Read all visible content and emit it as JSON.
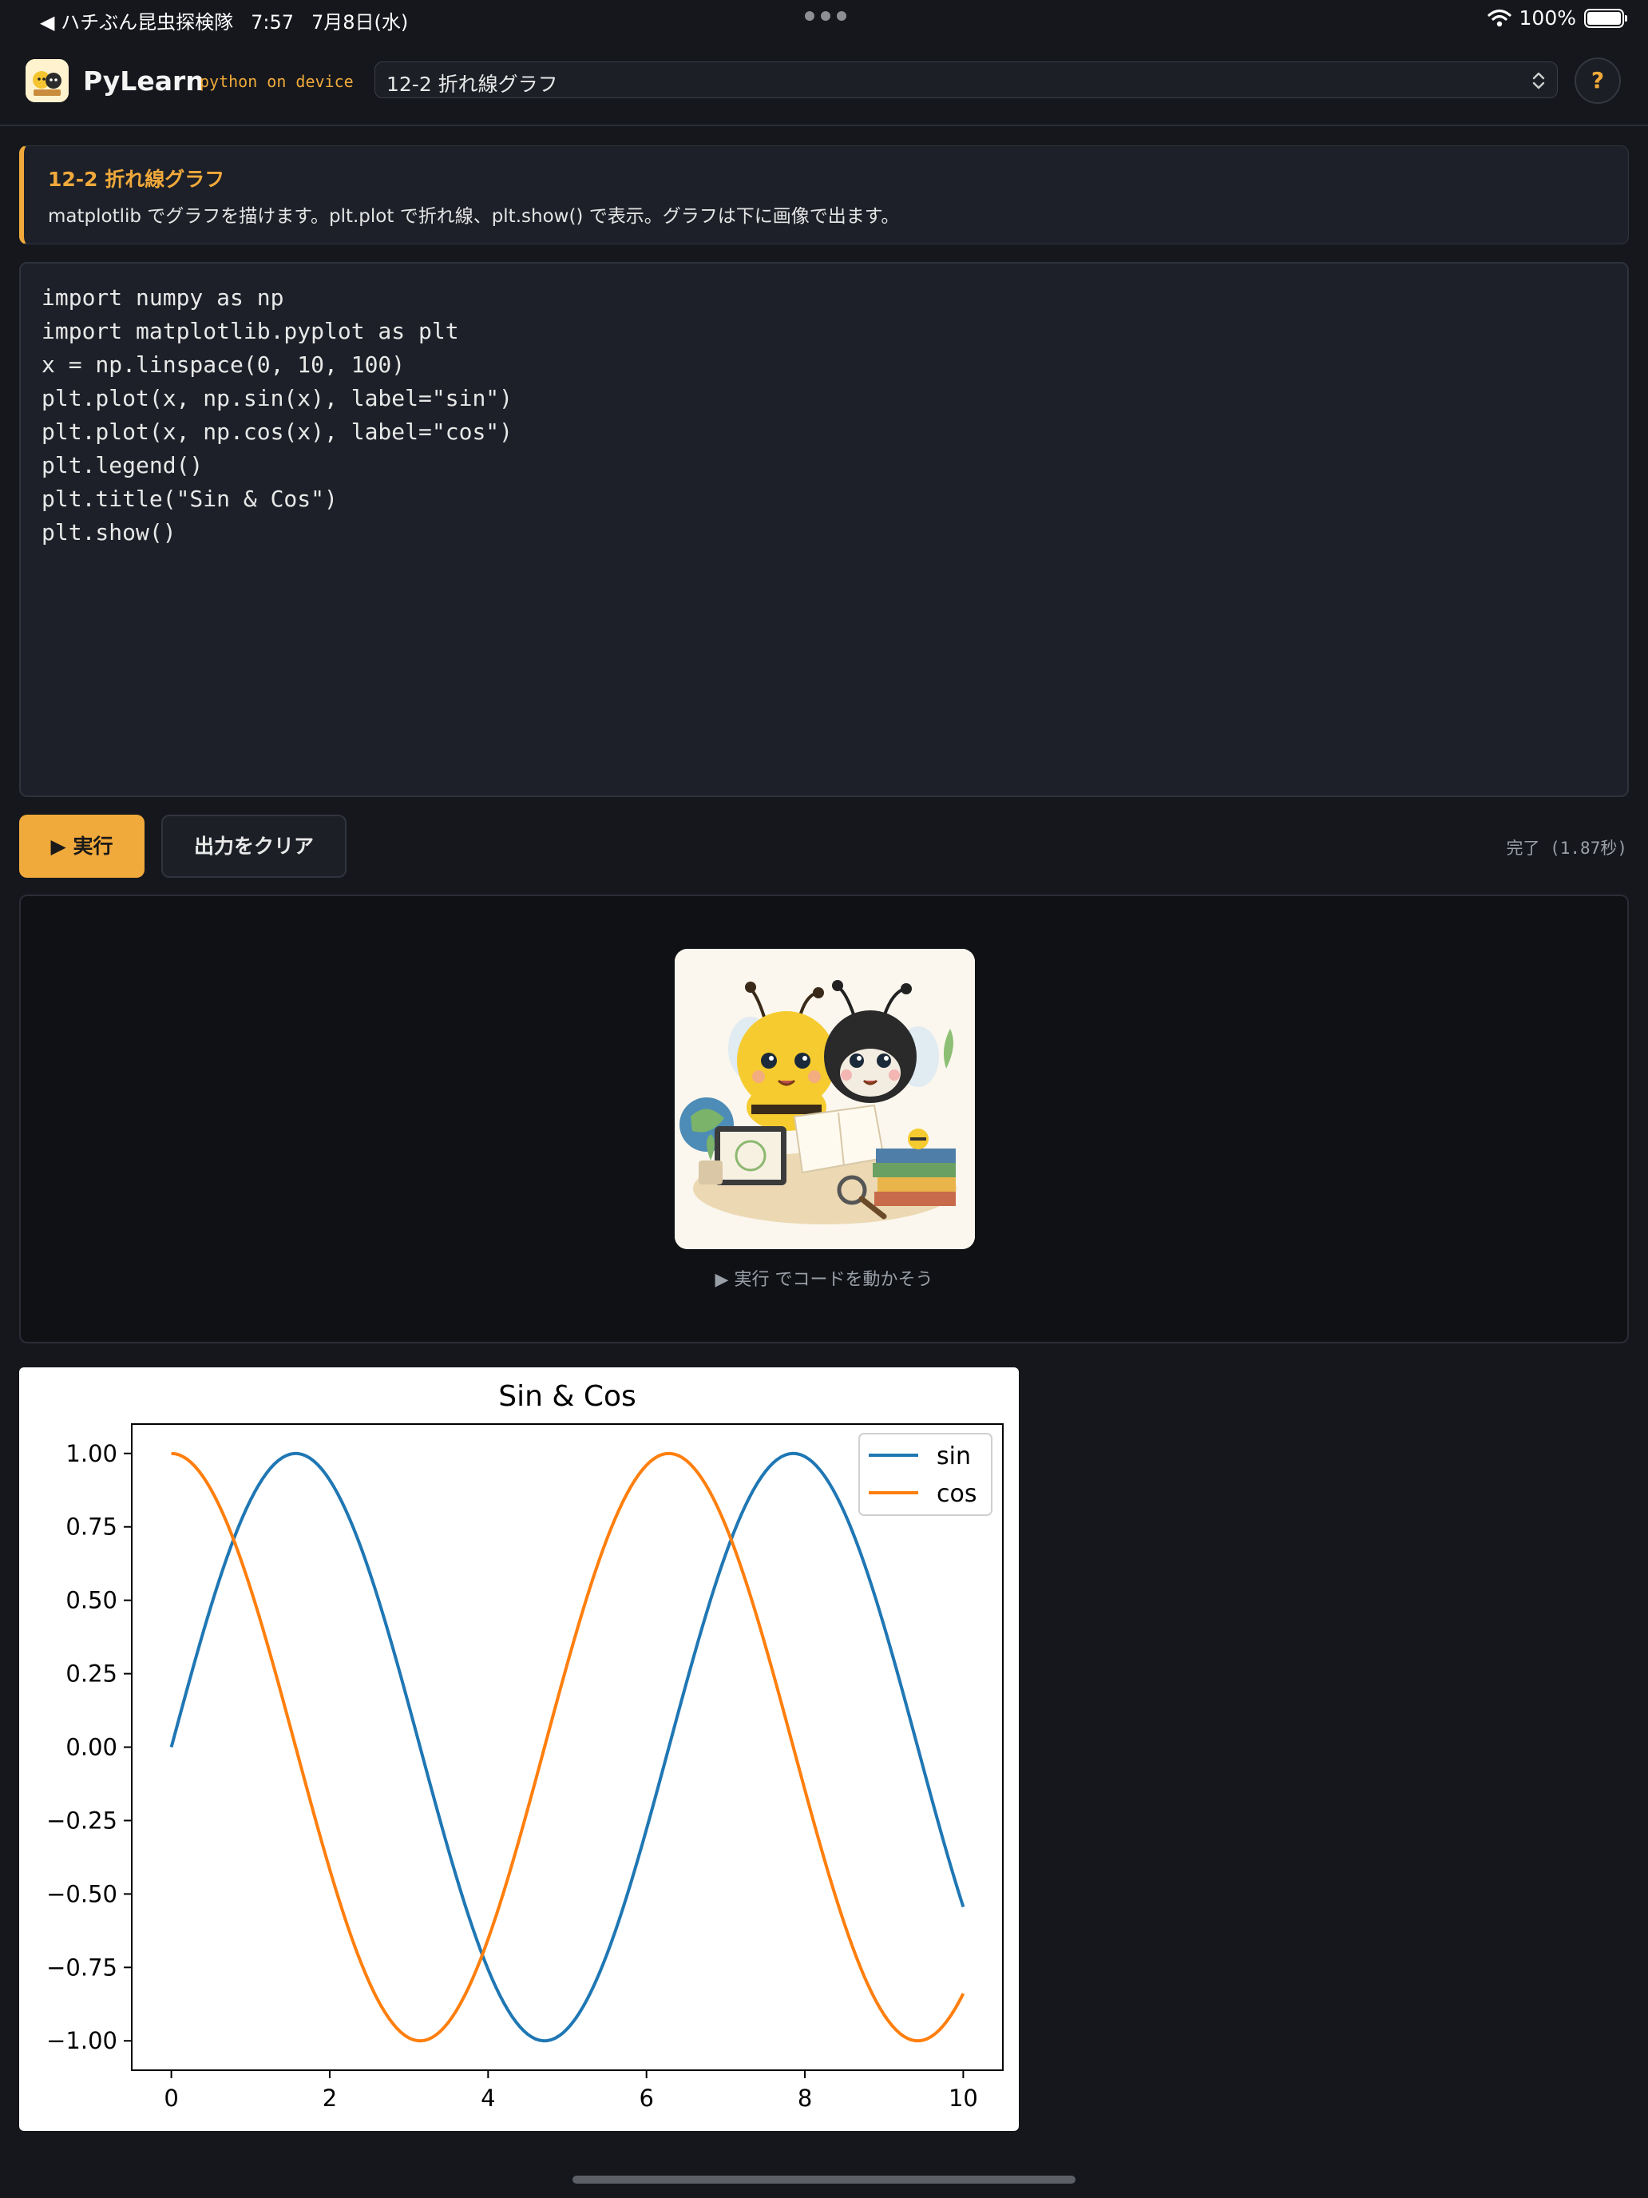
{
  "status_bar": {
    "back_app": "◀ ハチぶん昆虫探検隊",
    "time": "7:57",
    "date": "7月8日(水)",
    "battery": "100%"
  },
  "header": {
    "app_name": "PyLearn",
    "tagline": "python on device",
    "lesson_selected": "12-2 折れ線グラフ",
    "help_label": "?"
  },
  "lesson": {
    "title": "12-2 折れ線グラフ",
    "description": "matplotlib でグラフを描けます。plt.plot で折れ線、plt.show() で表示。グラフは下に画像で出ます。"
  },
  "editor": {
    "lines": [
      "import numpy as np",
      "import matplotlib.pyplot as plt",
      "x = np.linspace(0, 10, 100)",
      "plt.plot(x, np.sin(x), label=\"sin\")",
      "plt.plot(x, np.cos(x), label=\"cos\")",
      "plt.legend()",
      "plt.title(\"Sin & Cos\")",
      "plt.show()"
    ]
  },
  "actions": {
    "run_label": "▶ 実行",
    "clear_label": "出力をクリア",
    "status": "完了 (1.87秒)"
  },
  "output": {
    "hint": "▶ 実行 でコードを動かそう"
  },
  "chart_data": {
    "type": "line",
    "title": "Sin & Cos",
    "xlabel": "",
    "ylabel": "",
    "xlim": [
      -0.5,
      10.5
    ],
    "ylim": [
      -1.1,
      1.1
    ],
    "x_ticks": [
      0,
      2,
      4,
      6,
      8,
      10
    ],
    "y_ticks": [
      1.0,
      0.75,
      0.5,
      0.25,
      0.0,
      -0.25,
      -0.5,
      -0.75,
      -1.0
    ],
    "y_tick_labels": [
      "1.00",
      "0.75",
      "0.50",
      "0.25",
      "0.00",
      "−0.25",
      "−0.50",
      "−0.75",
      "−1.00"
    ],
    "x_tick_labels": [
      "0",
      "2",
      "4",
      "6",
      "8",
      "10"
    ],
    "legend_position": "top-right",
    "grid": false,
    "series": [
      {
        "name": "sin",
        "color": "#1f77b4",
        "x": [
          0,
          0.5,
          1,
          1.5,
          2,
          2.5,
          3,
          3.5,
          4,
          4.5,
          5,
          5.5,
          6,
          6.5,
          7,
          7.5,
          8,
          8.5,
          9,
          9.5,
          10
        ],
        "y": [
          0,
          0.479,
          0.841,
          0.997,
          0.909,
          0.598,
          0.141,
          -0.351,
          -0.757,
          -0.978,
          -0.959,
          -0.706,
          -0.279,
          0.215,
          0.657,
          0.938,
          0.989,
          0.798,
          0.412,
          -0.075,
          -0.544
        ]
      },
      {
        "name": "cos",
        "color": "#ff7f0e",
        "x": [
          0,
          0.5,
          1,
          1.5,
          2,
          2.5,
          3,
          3.5,
          4,
          4.5,
          5,
          5.5,
          6,
          6.5,
          7,
          7.5,
          8,
          8.5,
          9,
          9.5,
          10
        ],
        "y": [
          1,
          0.878,
          0.54,
          0.071,
          -0.416,
          -0.801,
          -0.99,
          -0.936,
          -0.654,
          -0.211,
          0.284,
          0.709,
          0.96,
          0.977,
          0.754,
          0.347,
          -0.146,
          -0.602,
          -0.911,
          -0.997,
          -0.839
        ]
      }
    ]
  }
}
